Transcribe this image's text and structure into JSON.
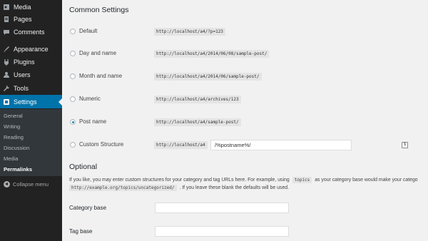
{
  "sidebar": {
    "items": [
      {
        "label": "Media",
        "icon": "media-icon"
      },
      {
        "label": "Pages",
        "icon": "pages-icon"
      },
      {
        "label": "Comments",
        "icon": "comments-icon"
      },
      {
        "label": "Appearance",
        "icon": "appearance-icon"
      },
      {
        "label": "Plugins",
        "icon": "plugins-icon"
      },
      {
        "label": "Users",
        "icon": "users-icon"
      },
      {
        "label": "Tools",
        "icon": "tools-icon"
      },
      {
        "label": "Settings",
        "icon": "settings-icon"
      }
    ],
    "submenu": [
      "General",
      "Writing",
      "Reading",
      "Discussion",
      "Media",
      "Permalinks"
    ],
    "current_submenu": "Permalinks",
    "collapse_label": "Collapse menu"
  },
  "main": {
    "common_heading": "Common Settings",
    "options": [
      {
        "label": "Default",
        "example": "http://localhost/a4/?p=123",
        "checked": false
      },
      {
        "label": "Day and name",
        "example": "http://localhost/a4/2014/06/08/sample-post/",
        "checked": false
      },
      {
        "label": "Month and name",
        "example": "http://localhost/a4/2014/06/sample-post/",
        "checked": false
      },
      {
        "label": "Numeric",
        "example": "http://localhost/a4/archives/123",
        "checked": false
      },
      {
        "label": "Post name",
        "example": "http://localhost/a4/sample-post/",
        "checked": true
      },
      {
        "label": "Custom Structure",
        "example": "http://localhost/a4",
        "checked": false
      }
    ],
    "custom_structure_value": "/%postname%/",
    "optional_heading": "Optional",
    "optional_text_1a": "If you like, you may enter custom structures for your category and tag URLs here. For example, using",
    "optional_code_1": "topics",
    "optional_text_1b": "as your category base would make your catego",
    "optional_code_2": "http://example.org/topics/uncategorized/",
    "optional_text_2": ". If you leave these blank the defaults will be used.",
    "category_base_label": "Category base",
    "category_base_value": "",
    "tag_base_label": "Tag base",
    "tag_base_value": ""
  },
  "colors": {
    "sidebar_bg": "#222222",
    "active": "#0073aa",
    "submenu_bg": "#32373c",
    "content_bg": "#f1f1f1",
    "radio_dot": "#1e8cbe"
  }
}
